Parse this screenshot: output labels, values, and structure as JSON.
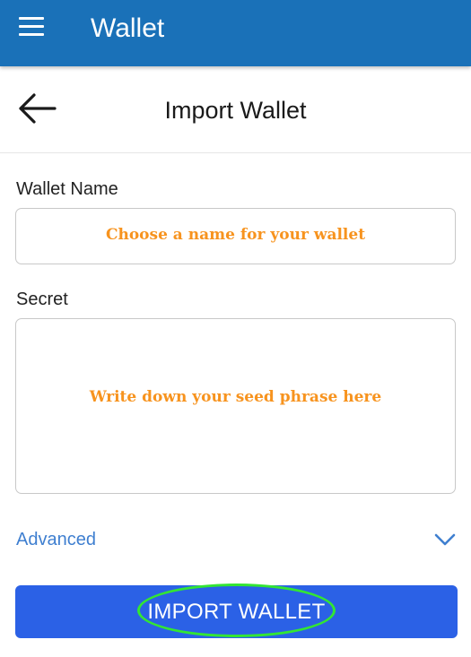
{
  "appbar": {
    "title": "Wallet",
    "menu_icon": "hamburger-menu-icon"
  },
  "header": {
    "title": "Import Wallet",
    "back_icon": "arrow-left-icon"
  },
  "wallet_name": {
    "label": "Wallet Name",
    "annotation": "Choose a  name for your wallet"
  },
  "secret": {
    "label": "Secret",
    "annotation": "Write down your seed phrase here"
  },
  "advanced": {
    "label": "Advanced",
    "icon": "chevron-down-icon"
  },
  "import_button": {
    "label": "IMPORT WALLET"
  },
  "colors": {
    "appbar": "#1a71b8",
    "accent_text": "#3f7fd0",
    "button": "#2b61e6",
    "annotation_orange": "#f7931e",
    "highlight_green": "#33e633"
  }
}
